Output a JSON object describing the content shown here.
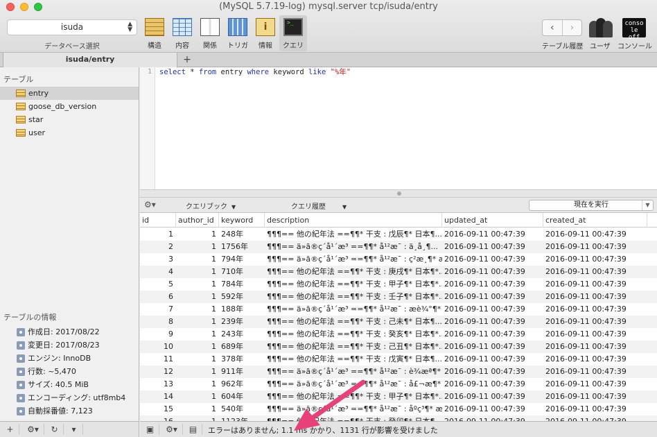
{
  "window": {
    "title": "(MySQL 5.7.19-log) mysql.server tcp/isuda/entry"
  },
  "toolbar": {
    "database_value": "isuda",
    "database_label": "データベース選択",
    "buttons": [
      {
        "label": "構造",
        "icon": "structure-icon"
      },
      {
        "label": "内容",
        "icon": "content-icon"
      },
      {
        "label": "関係",
        "icon": "relations-icon"
      },
      {
        "label": "トリガ",
        "icon": "triggers-icon"
      },
      {
        "label": "情報",
        "icon": "info-icon"
      },
      {
        "label": "クエリ",
        "icon": "query-icon"
      }
    ],
    "history_label": "テーブル履歴",
    "users_label": "ユーザ",
    "console_label": "コンソール",
    "console_icon_text": "conso le off"
  },
  "tab": {
    "label": "isuda/entry",
    "add": "+"
  },
  "sidebar": {
    "tables_heading": "テーブル",
    "tables": [
      "entry",
      "goose_db_version",
      "star",
      "user"
    ],
    "selected": "entry",
    "info_heading": "テーブルの情報",
    "info": [
      "作成日: 2017/08/22",
      "変更日: 2017/08/23",
      "エンジン: InnoDB",
      "行数: ~5,470",
      "サイズ: 40.5 MiB",
      "エンコーディング: utf8mb4",
      "自動採番値: 7,123"
    ]
  },
  "editor": {
    "line_number": "1",
    "query": "select * from entry where keyword like \"%年\""
  },
  "results_bar": {
    "favorites": "クエリブック",
    "history": "クエリ履歴",
    "run": "現在を実行"
  },
  "results": {
    "columns": [
      "id",
      "author_id",
      "keyword",
      "description",
      "updated_at",
      "created_at"
    ],
    "rows": [
      [
        "1",
        "1",
        "248年",
        "¶¶¶== 他の紀年法 ==¶¶* 干支 : 戊辰¶* 日本¶...",
        "2016-09-11 00:47:39",
        "2016-09-11 00:47:39"
      ],
      [
        "2",
        "1",
        "1756年",
        "¶¶¶== ä»ã®ç´å¹´æ³ ==¶¶* å¹²æ¯ : ä¸å¸¶...",
        "2016-09-11 00:47:39",
        "2016-09-11 00:47:39"
      ],
      [
        "3",
        "1",
        "794年",
        "¶¶¶== ä»ã®ç´å¹´æ³ ==¶¶* å¹²æ¯ : ç²æ¸¶* æ...",
        "2016-09-11 00:47:39",
        "2016-09-11 00:47:39"
      ],
      [
        "4",
        "1",
        "710年",
        "¶¶¶== 他の紀年法 ==¶¶* 干支 : 庚戌¶* 日本¶*...",
        "2016-09-11 00:47:39",
        "2016-09-11 00:47:39"
      ],
      [
        "5",
        "1",
        "784年",
        "¶¶¶== 他の紀年法 ==¶¶* 干支 : 甲子¶* 日本¶*...",
        "2016-09-11 00:47:39",
        "2016-09-11 00:47:39"
      ],
      [
        "6",
        "1",
        "592年",
        "¶¶¶== 他の紀年法 ==¶¶* 干支 : 壬子¶* 日本¶*...",
        "2016-09-11 00:47:39",
        "2016-09-11 00:47:39"
      ],
      [
        "7",
        "1",
        "188年",
        "¶¶¶== ä»ã®ç´å¹´æ³ ==¶¶* å¹²æ¯ : æè¾°¶* æ...",
        "2016-09-11 00:47:39",
        "2016-09-11 00:47:39"
      ],
      [
        "8",
        "1",
        "239年",
        "¶¶¶== 他の紀年法 ==¶¶* 干支 : 己未¶* 日本¶...",
        "2016-09-11 00:47:39",
        "2016-09-11 00:47:39"
      ],
      [
        "9",
        "1",
        "243年",
        "¶¶¶== 他の紀年法 ==¶¶* 干支 : 癸亥¶* 日本¶*...",
        "2016-09-11 00:47:39",
        "2016-09-11 00:47:39"
      ],
      [
        "10",
        "1",
        "689年",
        "¶¶¶== 他の紀年法 ==¶¶* 干支 : 己丑¶* 日本¶*...",
        "2016-09-11 00:47:39",
        "2016-09-11 00:47:39"
      ],
      [
        "11",
        "1",
        "378年",
        "¶¶¶== 他の紀年法 ==¶¶* 干支 : 戊寅¶* 日本¶...",
        "2016-09-11 00:47:39",
        "2016-09-11 00:47:39"
      ],
      [
        "12",
        "1",
        "911年",
        "¶¶¶== ä»ã®ç´å¹´æ³ ==¶¶* å¹²æ¯ : è¾æª¶* æ...",
        "2016-09-11 00:47:39",
        "2016-09-11 00:47:39"
      ],
      [
        "13",
        "1",
        "962年",
        "¶¶¶== ä»ã®ç´å¹´æ³ ==¶¶* å¹²æ¯ : å£¬æ¶* æ...",
        "2016-09-11 00:47:39",
        "2016-09-11 00:47:39"
      ],
      [
        "14",
        "1",
        "604年",
        "¶¶¶== 他の紀年法 ==¶¶* 干支 : 甲子¶* 日本¶*...",
        "2016-09-11 00:47:39",
        "2016-09-11 00:47:39"
      ],
      [
        "15",
        "1",
        "540年",
        "¶¶¶== ä»ã®ç´å¹´æ³ ==¶¶* å¹²æ¯ : åºç³¶* æ...",
        "2016-09-11 00:47:39",
        "2016-09-11 00:47:39"
      ],
      [
        "16",
        "1",
        "1123年",
        "¶¶¶== 他の紀年法 ==¶¶* 干支 : 癸卯¶* 日本¶...",
        "2016-09-11 00:47:39",
        "2016-09-11 00:47:39"
      ]
    ]
  },
  "status": {
    "message": "エラーはありません; 1.1 ms かかり、1131 行が影響を受けました"
  },
  "colors": {
    "accent": "#e8417a",
    "keyword": "#1e2fb6",
    "string": "#c41a16"
  }
}
